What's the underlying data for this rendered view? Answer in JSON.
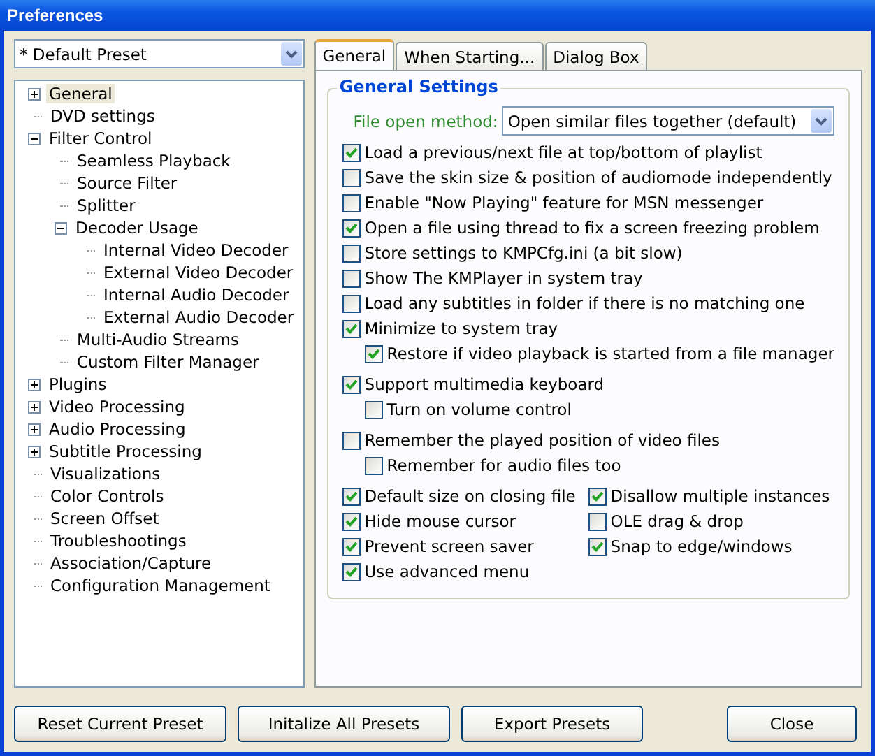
{
  "window": {
    "title": "Preferences"
  },
  "preset": {
    "value": "* Default Preset"
  },
  "tree": [
    {
      "label": "General",
      "selected": true,
      "expanded": false
    },
    {
      "label": "DVD settings",
      "selected": false
    },
    {
      "label": "Filter Control",
      "selected": false,
      "expanded": true,
      "children": [
        {
          "label": "Seamless Playback",
          "selected": false
        },
        {
          "label": "Source Filter",
          "selected": false
        },
        {
          "label": "Splitter",
          "selected": false
        },
        {
          "label": "Decoder Usage",
          "selected": false,
          "expanded": true,
          "children": [
            {
              "label": "Internal Video Decoder",
              "selected": false
            },
            {
              "label": "External Video Decoder",
              "selected": false
            },
            {
              "label": "Internal Audio Decoder",
              "selected": false
            },
            {
              "label": "External Audio Decoder",
              "selected": false
            }
          ]
        },
        {
          "label": "Multi-Audio Streams",
          "selected": false
        },
        {
          "label": "Custom Filter Manager",
          "selected": false
        }
      ]
    },
    {
      "label": "Plugins",
      "selected": false,
      "expanded": false
    },
    {
      "label": "Video Processing",
      "selected": false,
      "expanded": false
    },
    {
      "label": "Audio Processing",
      "selected": false,
      "expanded": false
    },
    {
      "label": "Subtitle Processing",
      "selected": false,
      "expanded": false
    },
    {
      "label": "Visualizations",
      "selected": false
    },
    {
      "label": "Color Controls",
      "selected": false
    },
    {
      "label": "Screen Offset",
      "selected": false
    },
    {
      "label": "Troubleshootings",
      "selected": false
    },
    {
      "label": "Association/Capture",
      "selected": false
    },
    {
      "label": "Configuration Management",
      "selected": false
    }
  ],
  "tabs": [
    {
      "label": "General",
      "selected": true
    },
    {
      "label": "When Starting...",
      "selected": false
    },
    {
      "label": "Dialog Box",
      "selected": false
    }
  ],
  "general_settings": {
    "title": "General Settings",
    "file_open_method": {
      "label": "File open method:",
      "value": "Open similar files together (default)"
    },
    "groups": [
      [
        {
          "label": "Load a previous/next file at top/bottom of playlist",
          "checked": true
        },
        {
          "label": "Save the skin size & position of audiomode independently",
          "checked": false
        },
        {
          "label": "Enable \"Now Playing\" feature for MSN messenger",
          "checked": false
        },
        {
          "label": "Open a file using thread to fix a screen freezing problem",
          "checked": true
        },
        {
          "label": "Store settings to KMPCfg.ini (a bit slow)",
          "checked": false
        },
        {
          "label": "Show The KMPlayer in system tray",
          "checked": false
        },
        {
          "label": "Load any subtitles in folder if there is no matching one",
          "checked": false
        },
        {
          "label": "Minimize to system tray",
          "checked": true,
          "children": [
            {
              "label": "Restore if video playback is started from a file manager",
              "checked": true
            }
          ]
        }
      ],
      [
        {
          "label": "Support multimedia keyboard",
          "checked": true,
          "children": [
            {
              "label": "Turn on volume control",
              "checked": false
            }
          ]
        }
      ],
      [
        {
          "label": "Remember the played position of video files",
          "checked": false,
          "children": [
            {
              "label": "Remember for audio files too",
              "checked": false
            }
          ]
        }
      ]
    ],
    "columns": [
      [
        {
          "label": "Default size on closing file",
          "checked": true
        },
        {
          "label": "Hide mouse cursor",
          "checked": true
        },
        {
          "label": "Prevent screen saver",
          "checked": true
        },
        {
          "label": "Use advanced menu",
          "checked": true
        }
      ],
      [
        {
          "label": "Disallow multiple instances",
          "checked": true
        },
        {
          "label": "OLE drag & drop",
          "checked": false
        },
        {
          "label": "Snap to edge/windows",
          "checked": true
        }
      ]
    ]
  },
  "buttons": [
    "Reset Current Preset",
    "Initalize All Presets",
    "Export Presets",
    "Close"
  ]
}
